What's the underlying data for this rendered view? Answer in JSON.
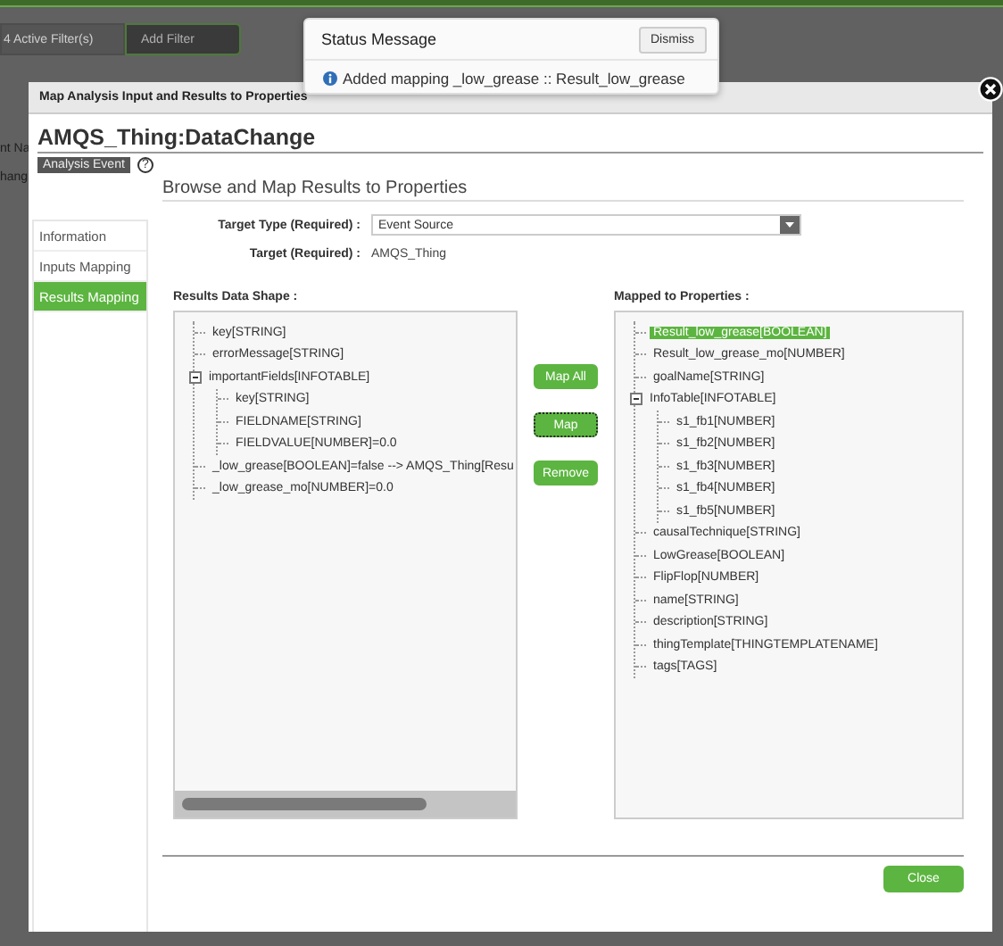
{
  "background": {
    "filter_count": "4 Active Filter(s)",
    "add_filter": "Add Filter",
    "column_fragment": "nt Na",
    "row_fragment": "hang"
  },
  "status": {
    "title": "Status Message",
    "dismiss": "Dismiss",
    "message": "Added mapping _low_grease :: Result_low_grease"
  },
  "dialog": {
    "title": "Map Analysis Input and Results to Properties",
    "heading": "AMQS_Thing:DataChange",
    "badge": "Analysis Event",
    "help": "?",
    "nav": [
      {
        "label": "Information",
        "selected": false
      },
      {
        "label": "Inputs Mapping",
        "selected": false
      },
      {
        "label": "Results Mapping",
        "selected": true
      }
    ],
    "section_title": "Browse and Map Results to Properties",
    "target_type": {
      "label": "Target Type (Required) :",
      "value": "Event Source"
    },
    "target": {
      "label": "Target (Required) :",
      "value": "AMQS_Thing"
    },
    "results": {
      "title": "Results Data Shape :",
      "items": [
        {
          "label": "key[STRING]",
          "selected": false
        },
        {
          "label": "errorMessage[STRING]",
          "selected": false
        },
        {
          "label": "importantFields[INFOTABLE]",
          "selected": false,
          "expanded": true,
          "children": [
            {
              "label": "key[STRING]",
              "selected": false
            },
            {
              "label": "FIELDNAME[STRING]",
              "selected": false
            },
            {
              "label": "FIELDVALUE[NUMBER]=0.0",
              "selected": false
            }
          ]
        },
        {
          "label": "_low_grease[BOOLEAN]=false --> AMQS_Thing[Resu",
          "selected": false
        },
        {
          "label": "_low_grease_mo[NUMBER]=0.0",
          "selected": false
        }
      ]
    },
    "actions": [
      {
        "label": "Map All",
        "focused": false
      },
      {
        "label": "Map",
        "focused": true
      },
      {
        "label": "Remove",
        "focused": false
      }
    ],
    "mapped": {
      "title": "Mapped to Properties :",
      "items": [
        {
          "label": "Result_low_grease[BOOLEAN]",
          "selected": true
        },
        {
          "label": "Result_low_grease_mo[NUMBER]",
          "selected": false
        },
        {
          "label": "goalName[STRING]",
          "selected": false
        },
        {
          "label": "InfoTable[INFOTABLE]",
          "selected": false,
          "expanded": true,
          "children": [
            {
              "label": "s1_fb1[NUMBER]",
              "selected": false
            },
            {
              "label": "s1_fb2[NUMBER]",
              "selected": false
            },
            {
              "label": "s1_fb3[NUMBER]",
              "selected": false
            },
            {
              "label": "s1_fb4[NUMBER]",
              "selected": false
            },
            {
              "label": "s1_fb5[NUMBER]",
              "selected": false
            }
          ]
        },
        {
          "label": "causalTechnique[STRING]",
          "selected": false
        },
        {
          "label": "LowGrease[BOOLEAN]",
          "selected": false
        },
        {
          "label": "FlipFlop[NUMBER]",
          "selected": false
        },
        {
          "label": "name[STRING]",
          "selected": false
        },
        {
          "label": "description[STRING]",
          "selected": false
        },
        {
          "label": "thingTemplate[THINGTEMPLATENAME]",
          "selected": false
        },
        {
          "label": "tags[TAGS]",
          "selected": false
        }
      ]
    },
    "close": "Close"
  }
}
